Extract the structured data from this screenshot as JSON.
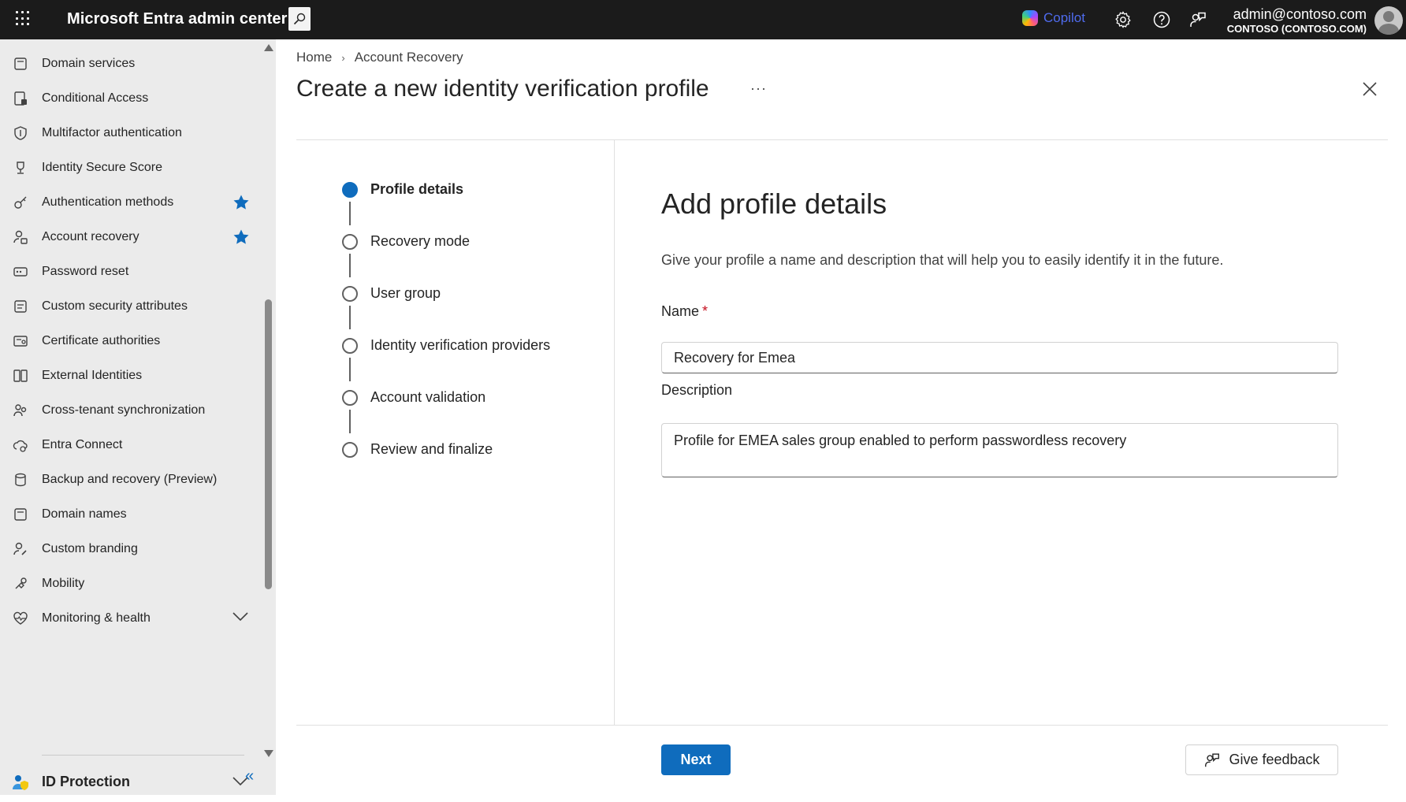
{
  "header": {
    "app_title": "Microsoft Entra admin center",
    "copilot_label": "Copilot",
    "account_email": "admin@contoso.com",
    "account_tenant": "CONTOSO (CONTOSO.COM)"
  },
  "sidebar": {
    "items": [
      {
        "label": "Domain services",
        "icon": "domain-services-icon",
        "starred": false
      },
      {
        "label": "Conditional Access",
        "icon": "conditional-access-icon",
        "starred": false
      },
      {
        "label": "Multifactor authentication",
        "icon": "shield-icon",
        "starred": false
      },
      {
        "label": "Identity Secure Score",
        "icon": "trophy-icon",
        "starred": false
      },
      {
        "label": "Authentication methods",
        "icon": "key-icon",
        "starred": true
      },
      {
        "label": "Account recovery",
        "icon": "person-lock-icon",
        "starred": true
      },
      {
        "label": "Password reset",
        "icon": "password-icon",
        "starred": false
      },
      {
        "label": "Custom security attributes",
        "icon": "attributes-icon",
        "starred": false
      },
      {
        "label": "Certificate authorities",
        "icon": "certificate-icon",
        "starred": false
      },
      {
        "label": "External Identities",
        "icon": "external-identities-icon",
        "starred": false
      },
      {
        "label": "Cross-tenant synchronization",
        "icon": "people-sync-icon",
        "starred": false
      },
      {
        "label": "Entra Connect",
        "icon": "cloud-sync-icon",
        "starred": false
      },
      {
        "label": "Backup and recovery (Preview)",
        "icon": "database-icon",
        "starred": false
      },
      {
        "label": "Domain names",
        "icon": "domain-names-icon",
        "starred": false
      },
      {
        "label": "Custom branding",
        "icon": "paint-person-icon",
        "starred": false
      },
      {
        "label": "Mobility",
        "icon": "mobility-icon",
        "starred": false
      },
      {
        "label": "Monitoring & health",
        "icon": "heart-pulse-icon",
        "starred": false,
        "expandable": true
      }
    ],
    "section": {
      "label": "ID Protection"
    }
  },
  "breadcrumb": [
    "Home",
    "Account Recovery"
  ],
  "page": {
    "title": "Create a new identity verification profile",
    "more": "···"
  },
  "stepper": {
    "steps": [
      {
        "label": "Profile details",
        "active": true
      },
      {
        "label": "Recovery mode",
        "active": false
      },
      {
        "label": "User group",
        "active": false
      },
      {
        "label": "Identity verification providers",
        "active": false
      },
      {
        "label": "Account validation",
        "active": false
      },
      {
        "label": "Review and finalize",
        "active": false
      }
    ]
  },
  "form": {
    "title": "Add profile details",
    "description": "Give your profile a name and description that will help you to easily identify it in the future.",
    "name_label": "Name",
    "required_mark": "*",
    "name_value": "Recovery for Emea",
    "description_label": "Description",
    "description_value": "Profile for EMEA sales group enabled to perform passwordless recovery"
  },
  "footer": {
    "next_label": "Next",
    "feedback_label": "Give feedback"
  },
  "colors": {
    "accent": "#0f6cbd",
    "topbar": "#1b1b1b",
    "sidebar_bg": "#ebebeb",
    "required": "#c50f1f"
  }
}
